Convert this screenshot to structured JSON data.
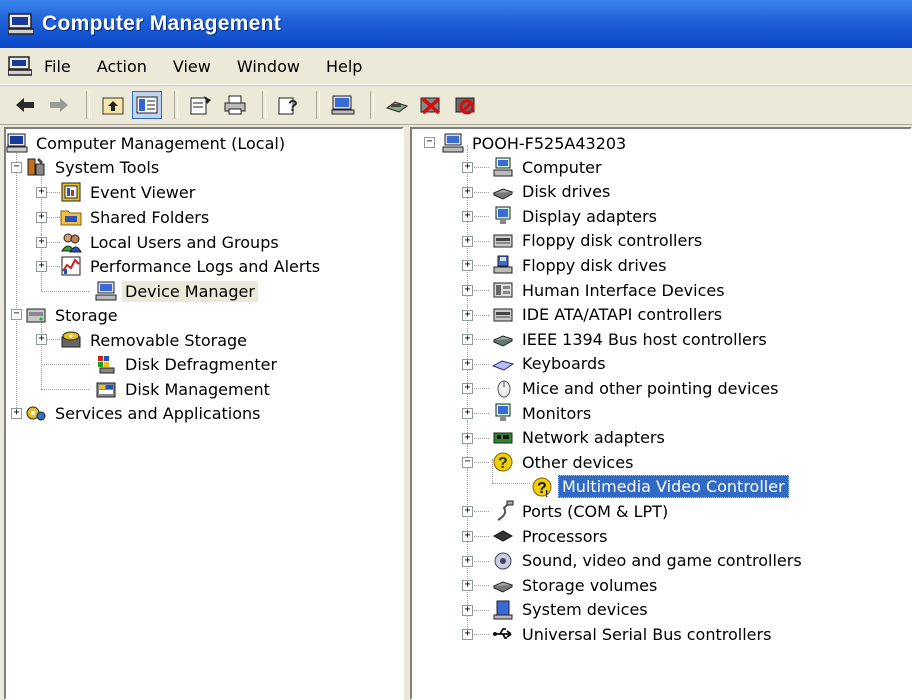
{
  "window": {
    "title": "Computer Management"
  },
  "menu": {
    "items": [
      "File",
      "Action",
      "View",
      "Window",
      "Help"
    ]
  },
  "toolbar": {
    "buttons": [
      "back-icon",
      "forward-icon",
      "up-folder-icon",
      "show-hide-tree-icon",
      "properties-icon",
      "print-icon",
      "help-icon",
      "device-scan-icon",
      "update-driver-icon",
      "uninstall-icon",
      "disable-icon"
    ]
  },
  "left_tree": {
    "root": "Computer Management (Local)",
    "system_tools": "System Tools",
    "event_viewer": "Event Viewer",
    "shared_folders": "Shared Folders",
    "local_users": "Local Users and Groups",
    "perf_logs": "Performance Logs and Alerts",
    "device_manager": "Device Manager",
    "storage": "Storage",
    "removable_storage": "Removable Storage",
    "disk_defrag": "Disk Defragmenter",
    "disk_mgmt": "Disk Management",
    "services_apps": "Services and Applications"
  },
  "right_tree": {
    "root": "POOH-F525A43203",
    "items": [
      "Computer",
      "Disk drives",
      "Display adapters",
      "Floppy disk controllers",
      "Floppy disk drives",
      "Human Interface Devices",
      "IDE ATA/ATAPI controllers",
      "IEEE 1394 Bus host controllers",
      "Keyboards",
      "Mice and other pointing devices",
      "Monitors",
      "Network adapters",
      "Other devices",
      "Multimedia Video Controller",
      "Ports (COM & LPT)",
      "Processors",
      "Sound, video and game controllers",
      "Storage volumes",
      "System devices",
      "Universal Serial Bus controllers"
    ]
  },
  "colors": {
    "title_bar": "#0a48c8",
    "chrome": "#ece9d8",
    "selection": "#316ac5"
  }
}
